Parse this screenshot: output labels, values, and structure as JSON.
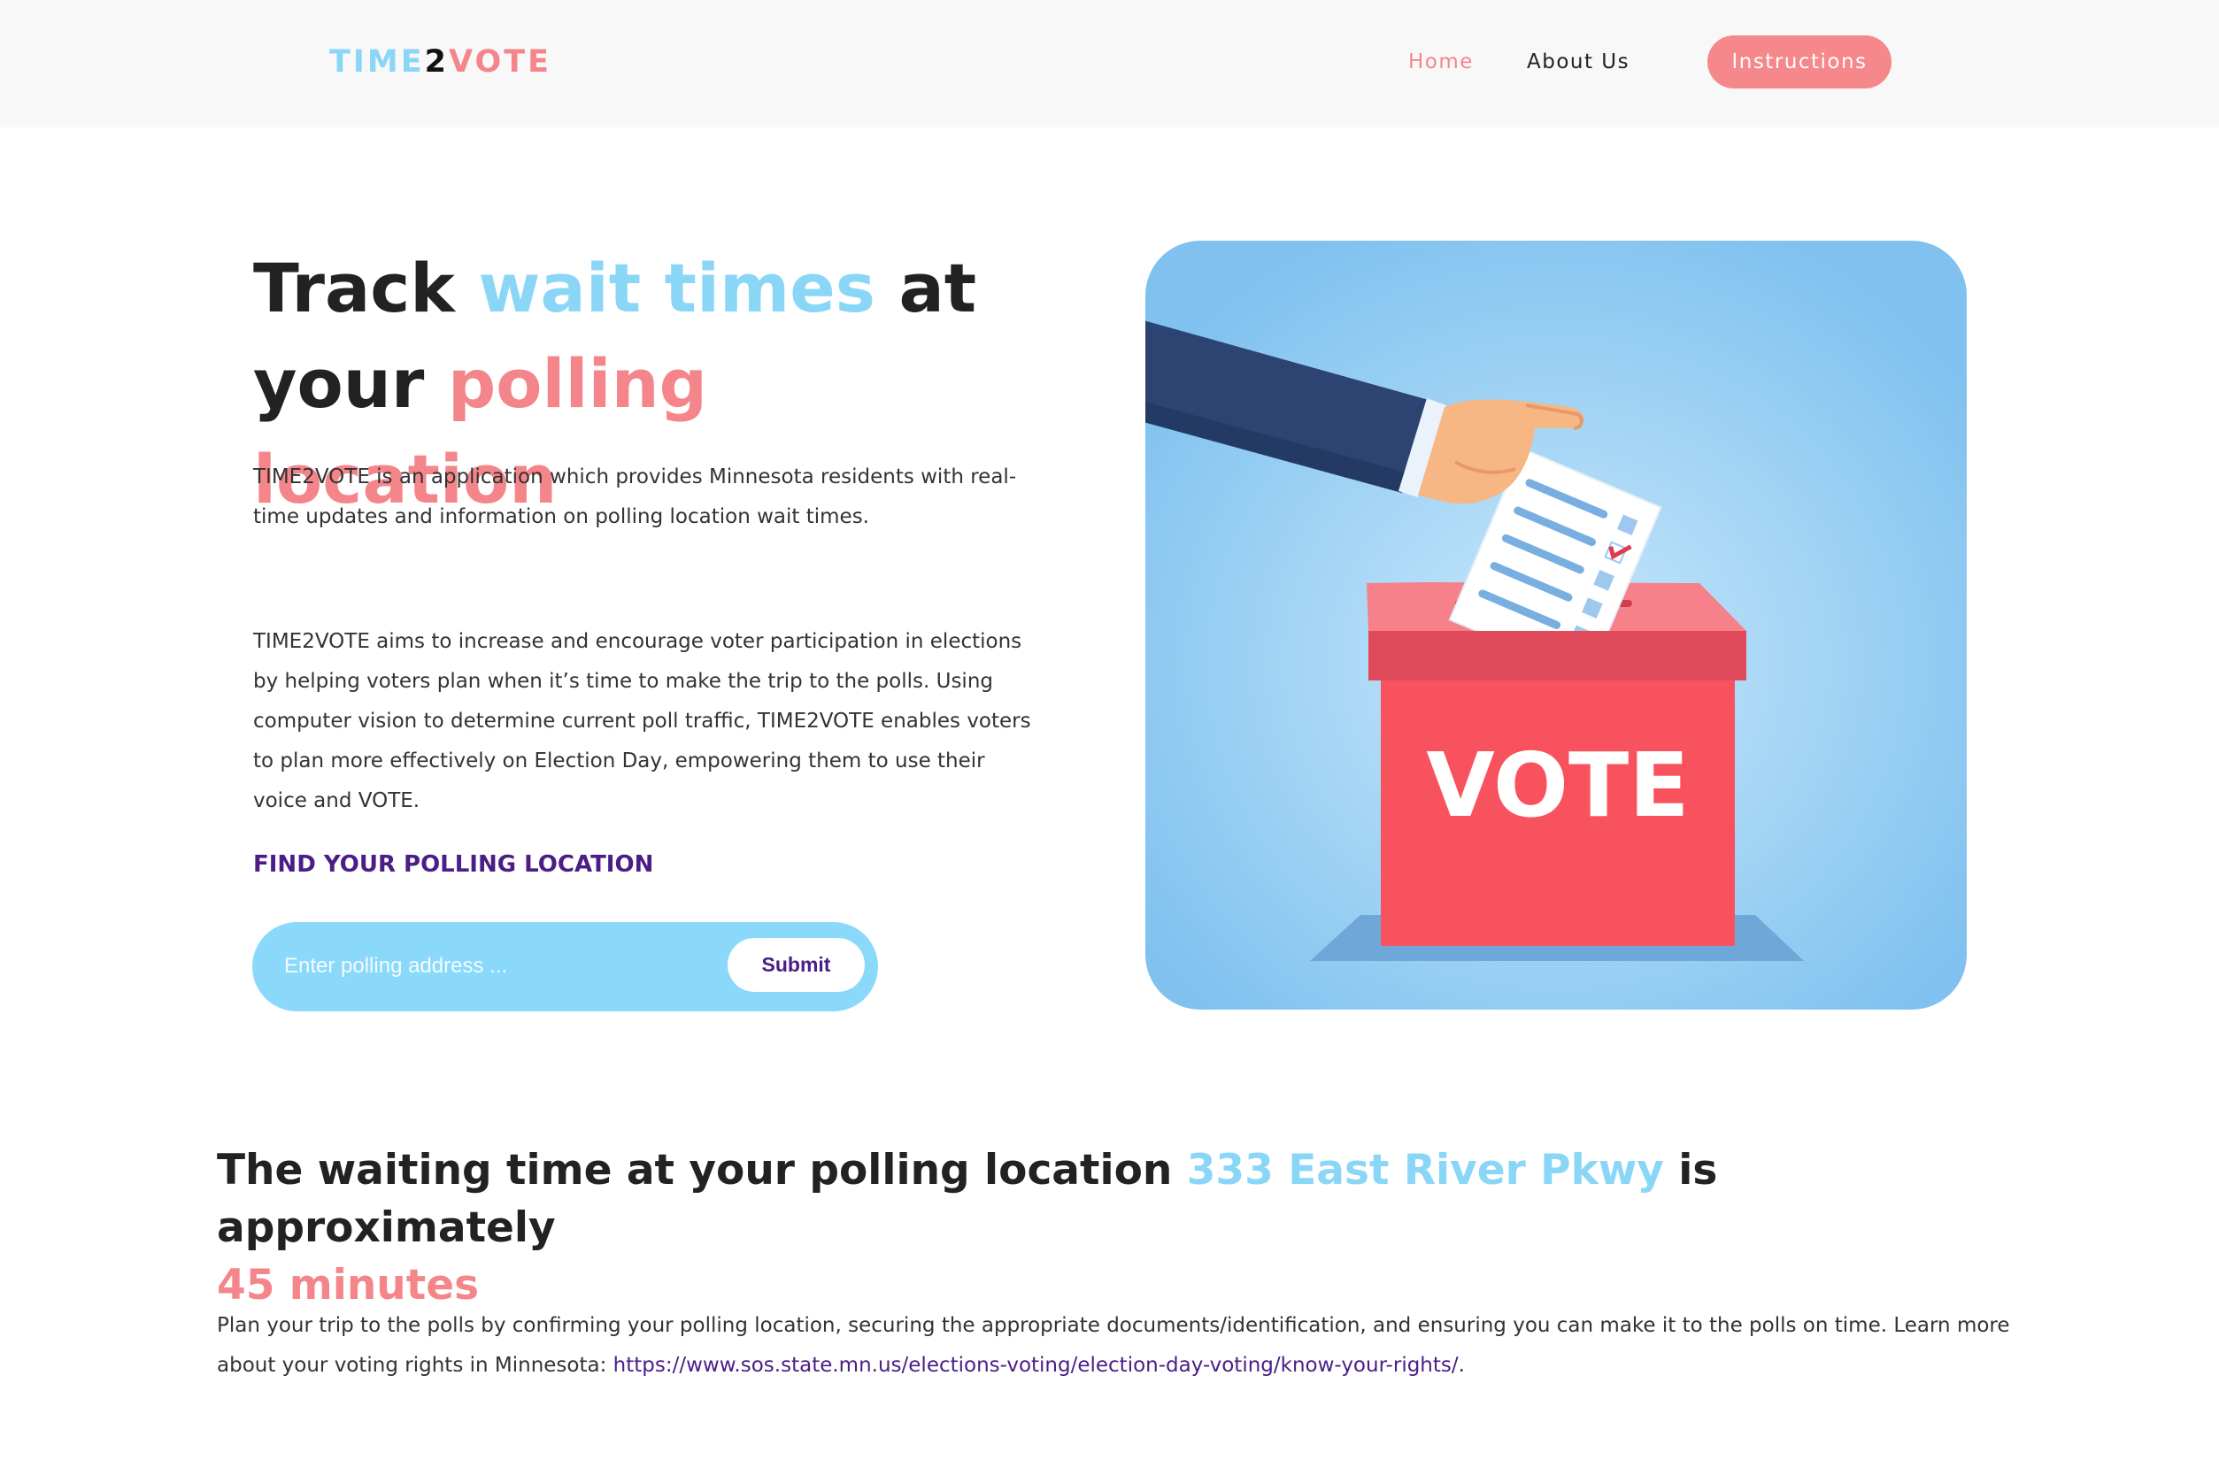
{
  "header": {
    "logo": {
      "part1": "TIME",
      "part2": "2",
      "part3": "VOTE"
    },
    "nav": {
      "home": "Home",
      "about": "About Us",
      "instructions": "Instructions"
    }
  },
  "hero": {
    "title_1": "Track ",
    "title_highlight_1": "wait times",
    "title_2": " at your ",
    "title_highlight_2": "polling location",
    "para1": "TIME2VOTE is an application which provides Minnesota residents with real-time updates and information on polling location wait times.",
    "para2": "TIME2VOTE aims to increase and encourage voter participation in elections by helping voters plan when it’s time to make the trip to the polls. Using computer vision to determine current poll traffic, TIME2VOTE enables voters to plan more effectively on Election Day, empowering them to use their voice and VOTE.",
    "find_heading": "FIND YOUR POLLING LOCATION",
    "search_placeholder": "Enter polling address ...",
    "submit_label": "Submit"
  },
  "illustration": {
    "box_text": "VOTE"
  },
  "result": {
    "prefix": "The waiting time at your polling location ",
    "location": "333 East River Pkwy",
    "middle": " is approximately ",
    "wait_time": "45 minutes",
    "para_text": "Plan your trip to the polls by confirming your polling location, securing the appropriate documents/identification, and ensuring you can make it to the polls on time. Learn more about your voting rights in Minnesota: ",
    "link_text": "https://www.sos.state.mn.us/elections-voting/election-day-voting/know-your-rights/",
    "para_end": "."
  },
  "colors": {
    "accent_blue": "#8ad6f7",
    "accent_pink": "#f4868b",
    "accent_purple": "#4b1d87",
    "header_bg": "#f8f8f8"
  }
}
